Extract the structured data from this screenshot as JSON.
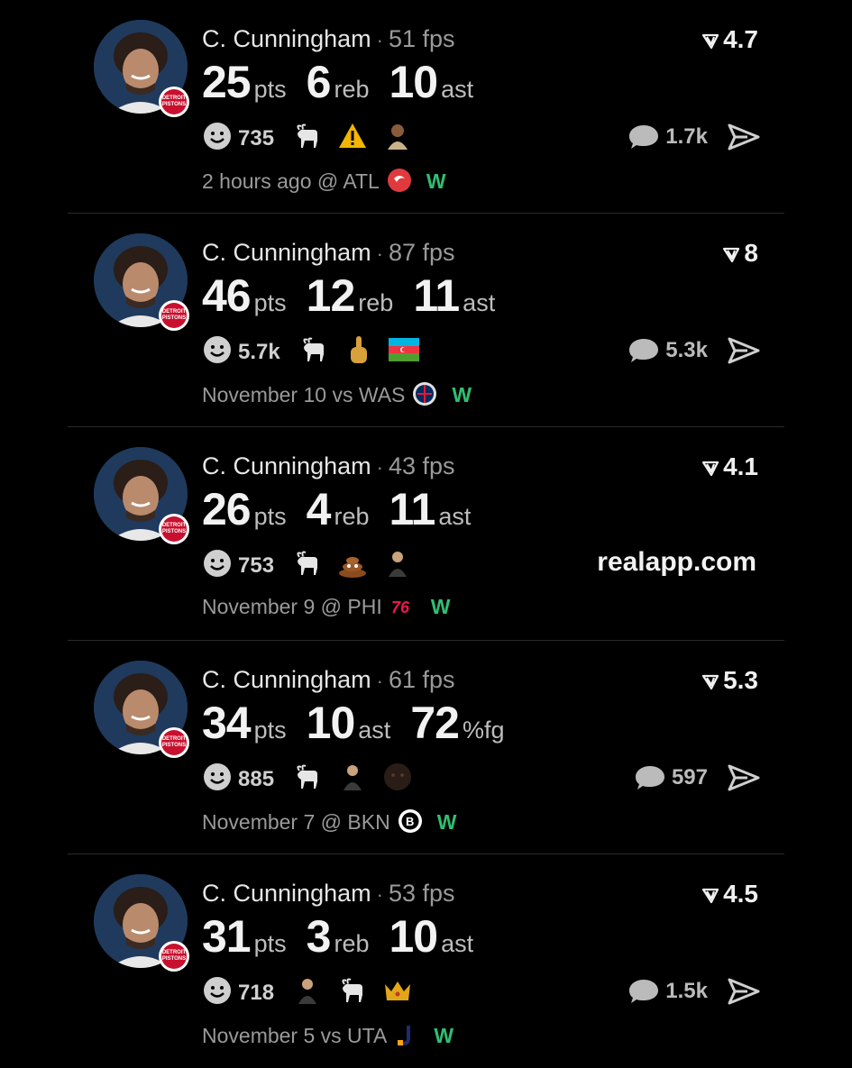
{
  "posts": [
    {
      "player": "C. Cunningham",
      "separator": "·",
      "fps": "51 fps",
      "rating": "4.7",
      "stats": [
        {
          "num": "25",
          "unit": "pts"
        },
        {
          "num": "6",
          "unit": "reb"
        },
        {
          "num": "10",
          "unit": "ast"
        }
      ],
      "reaction_count": "735",
      "reactions": [
        "smiley-icon",
        "goat-icon",
        "warning-icon",
        "player-emoji-icon"
      ],
      "comments": "1.7k",
      "meta": "2 hours ago @ ATL",
      "team_logo": "hawks-logo-icon",
      "result": "W"
    },
    {
      "player": "C. Cunningham",
      "separator": "·",
      "fps": "87 fps",
      "rating": "8",
      "stats": [
        {
          "num": "46",
          "unit": "pts"
        },
        {
          "num": "12",
          "unit": "reb"
        },
        {
          "num": "11",
          "unit": "ast"
        }
      ],
      "reaction_count": "5.7k",
      "reactions": [
        "smiley-icon",
        "goat-icon",
        "middle-finger-icon",
        "azerbaijan-flag-icon"
      ],
      "comments": "5.3k",
      "meta": "November 10 vs WAS",
      "team_logo": "wizards-logo-icon",
      "result": "W"
    },
    {
      "player": "C. Cunningham",
      "separator": "·",
      "fps": "43 fps",
      "rating": "4.1",
      "stats": [
        {
          "num": "26",
          "unit": "pts"
        },
        {
          "num": "4",
          "unit": "reb"
        },
        {
          "num": "11",
          "unit": "ast"
        }
      ],
      "reaction_count": "753",
      "reactions": [
        "smiley-icon",
        "goat-icon",
        "poop-icon",
        "person-emoji-icon"
      ],
      "promo": "realapp.com",
      "meta": "November 9 @ PHI",
      "team_logo": "76ers-logo-icon",
      "result": "W"
    },
    {
      "player": "C. Cunningham",
      "separator": "·",
      "fps": "61 fps",
      "rating": "5.3",
      "stats": [
        {
          "num": "34",
          "unit": "pts"
        },
        {
          "num": "10",
          "unit": "ast"
        },
        {
          "num": "72",
          "unit": "%fg"
        }
      ],
      "reaction_count": "885",
      "reactions": [
        "smiley-icon",
        "goat-icon",
        "person-emoji-icon",
        "dark-face-icon"
      ],
      "comments": "597",
      "meta": "November 7 @ BKN",
      "team_logo": "nets-logo-icon",
      "result": "W"
    },
    {
      "player": "C. Cunningham",
      "separator": "·",
      "fps": "53 fps",
      "rating": "4.5",
      "stats": [
        {
          "num": "31",
          "unit": "pts"
        },
        {
          "num": "3",
          "unit": "reb"
        },
        {
          "num": "10",
          "unit": "ast"
        }
      ],
      "reaction_count": "718",
      "reactions": [
        "smiley-icon",
        "person-emoji-icon",
        "goat-icon",
        "crown-icon"
      ],
      "comments": "1.5k",
      "meta": "November 5 vs UTA",
      "team_logo": "jazz-logo-icon",
      "result": "W"
    }
  ],
  "colors": {
    "background": "#000000",
    "win": "#2fbf71",
    "pistons": "#c8102e"
  }
}
